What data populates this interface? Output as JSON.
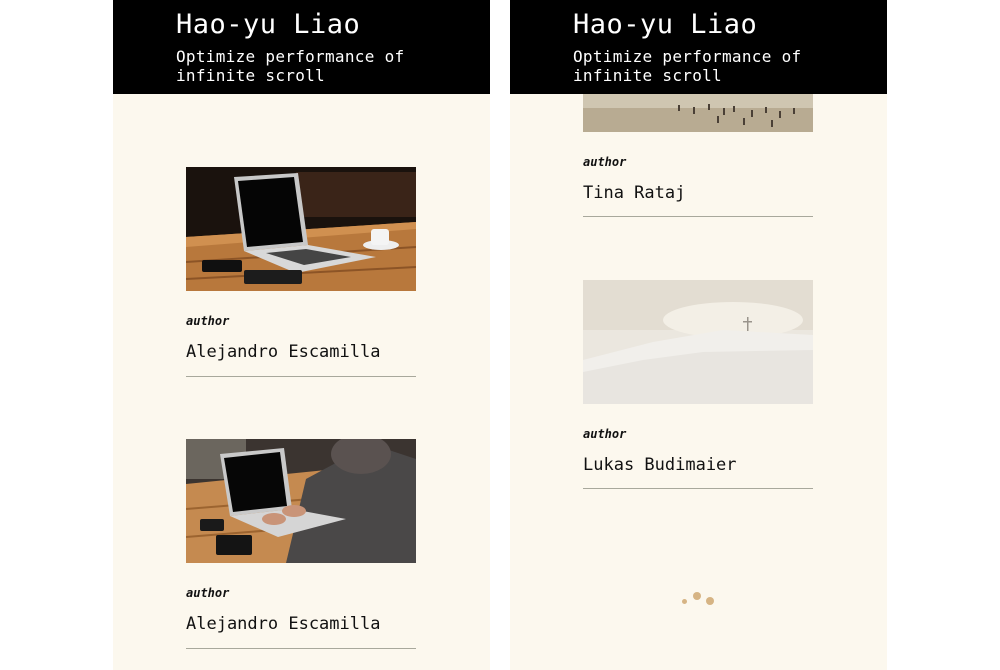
{
  "header": {
    "title": "Hao-yu Liao",
    "subtitle": "Optimize performance of infinite scroll"
  },
  "left_feed": [
    {
      "label": "author",
      "author": "Alejandro Escamilla"
    },
    {
      "label": "author",
      "author": "Alejandro Escamilla"
    }
  ],
  "right_feed": [
    {
      "label": "author",
      "author": "Tina Rataj"
    },
    {
      "label": "author",
      "author": "Lukas Budimaier"
    }
  ],
  "colors": {
    "header_bg": "#000000",
    "page_bg": "#fcf8ee",
    "loader": "#d6b484"
  },
  "icons": {
    "loader": "loading-dots-icon"
  }
}
